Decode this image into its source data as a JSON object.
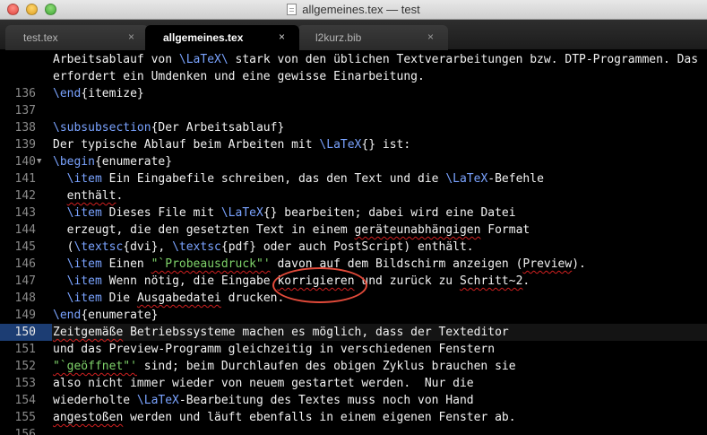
{
  "window": {
    "title": "allgemeines.tex — test"
  },
  "tabs": [
    {
      "label": "test.tex",
      "close": "×",
      "active": false
    },
    {
      "label": "allgemeines.tex",
      "close": "×",
      "active": true
    },
    {
      "label": "l2kurz.bib",
      "close": "×",
      "active": false
    }
  ],
  "editor": {
    "current_line": "150",
    "lines": [
      {
        "num": "",
        "tokens": [
          {
            "t": "Arbeitsablauf von "
          },
          {
            "t": "\\LaTeX\\",
            "c": "cmd"
          },
          {
            "t": " stark von den üblichen Textverarbeitungen bzw. DTP-Programmen. Das"
          }
        ]
      },
      {
        "num": "",
        "tokens": [
          {
            "t": "erfordert ein Umdenken und eine gewisse Einarbeitung."
          }
        ]
      },
      {
        "num": "136",
        "tokens": [
          {
            "t": "\\end",
            "c": "cmd"
          },
          {
            "t": "{itemize}"
          }
        ]
      },
      {
        "num": "137",
        "tokens": []
      },
      {
        "num": "138",
        "tokens": [
          {
            "t": "\\subsubsection",
            "c": "cmd"
          },
          {
            "t": "{Der Arbeitsablauf}"
          }
        ]
      },
      {
        "num": "139",
        "tokens": [
          {
            "t": "Der typische Ablauf beim Arbeiten mit "
          },
          {
            "t": "\\LaTeX",
            "c": "cmd"
          },
          {
            "t": "{} ist:"
          }
        ]
      },
      {
        "num": "140",
        "fold": "▼",
        "tokens": [
          {
            "t": "\\begin",
            "c": "cmd"
          },
          {
            "t": "{enumerate}"
          }
        ]
      },
      {
        "num": "141",
        "tokens": [
          {
            "t": "  "
          },
          {
            "t": "\\item",
            "c": "cmd"
          },
          {
            "t": " Ein Eingabefile schreiben, das den Text und die "
          },
          {
            "t": "\\LaTeX",
            "c": "cmd"
          },
          {
            "t": "-Befehle"
          }
        ]
      },
      {
        "num": "142",
        "tokens": [
          {
            "t": "  "
          },
          {
            "t": "enthält",
            "s": 1
          },
          {
            "t": "."
          }
        ]
      },
      {
        "num": "143",
        "tokens": [
          {
            "t": "  "
          },
          {
            "t": "\\item",
            "c": "cmd"
          },
          {
            "t": " Dieses File mit "
          },
          {
            "t": "\\LaTeX",
            "c": "cmd"
          },
          {
            "t": "{} bearbeiten; dabei wird eine Datei"
          }
        ]
      },
      {
        "num": "144",
        "tokens": [
          {
            "t": "  erzeugt, die den gesetzten Text in einem "
          },
          {
            "t": "geräteunabhängigen",
            "s": 1
          },
          {
            "t": " Format"
          }
        ]
      },
      {
        "num": "145",
        "tokens": [
          {
            "t": "  ("
          },
          {
            "t": "\\textsc",
            "c": "cmd"
          },
          {
            "t": "{dvi}, "
          },
          {
            "t": "\\textsc",
            "c": "cmd"
          },
          {
            "t": "{pdf} oder auch PostScript) enthält."
          }
        ]
      },
      {
        "num": "146",
        "tokens": [
          {
            "t": "  "
          },
          {
            "t": "\\item",
            "c": "cmd"
          },
          {
            "t": " Einen "
          },
          {
            "t": "\"`Probeausdruck\"'",
            "c": "str",
            "s": 1
          },
          {
            "t": " davon auf dem Bildschirm anzeigen ("
          },
          {
            "t": "Preview",
            "s": 1
          },
          {
            "t": ")."
          }
        ]
      },
      {
        "num": "147",
        "tokens": [
          {
            "t": "  "
          },
          {
            "t": "\\item",
            "c": "cmd"
          },
          {
            "t": " Wenn nötig, die Eingabe "
          },
          {
            "t": "korrigieren",
            "s": 1
          },
          {
            "t": " und zurück zu "
          },
          {
            "t": "Schritt~2",
            "s": 1
          },
          {
            "t": "."
          }
        ]
      },
      {
        "num": "148",
        "tokens": [
          {
            "t": "  "
          },
          {
            "t": "\\item",
            "c": "cmd"
          },
          {
            "t": " Die "
          },
          {
            "t": "Ausgabedatei",
            "s": 1
          },
          {
            "t": " drucken."
          }
        ]
      },
      {
        "num": "149",
        "tokens": [
          {
            "t": "\\end",
            "c": "cmd"
          },
          {
            "t": "{enumerate}"
          }
        ]
      },
      {
        "num": "150",
        "tokens": [
          {
            "t": "Zeitgemäße",
            "s": 1
          },
          {
            "t": " Betriebssysteme machen es möglich, dass der Texteditor"
          }
        ]
      },
      {
        "num": "151",
        "tokens": [
          {
            "t": "und das Preview-Programm gleichzeitig in verschiedenen Fenstern"
          }
        ]
      },
      {
        "num": "152",
        "tokens": [
          {
            "t": "\"`geöffnet\"'",
            "c": "str",
            "s": 1
          },
          {
            "t": " sind; beim Durchlaufen des obigen Zyklus brauchen sie"
          }
        ]
      },
      {
        "num": "153",
        "tokens": [
          {
            "t": "also nicht immer wieder von neuem gestartet werden.  Nur die"
          }
        ]
      },
      {
        "num": "154",
        "tokens": [
          {
            "t": "wiederholte "
          },
          {
            "t": "\\LaTeX",
            "c": "cmd"
          },
          {
            "t": "-Bearbeitung des Textes muss noch von Hand"
          }
        ]
      },
      {
        "num": "155",
        "tokens": [
          {
            "t": "angestoßen",
            "s": 1
          },
          {
            "t": " werden und läuft ebenfalls in einem eigenen Fenster ab."
          }
        ]
      },
      {
        "num": "156",
        "tokens": []
      }
    ]
  }
}
